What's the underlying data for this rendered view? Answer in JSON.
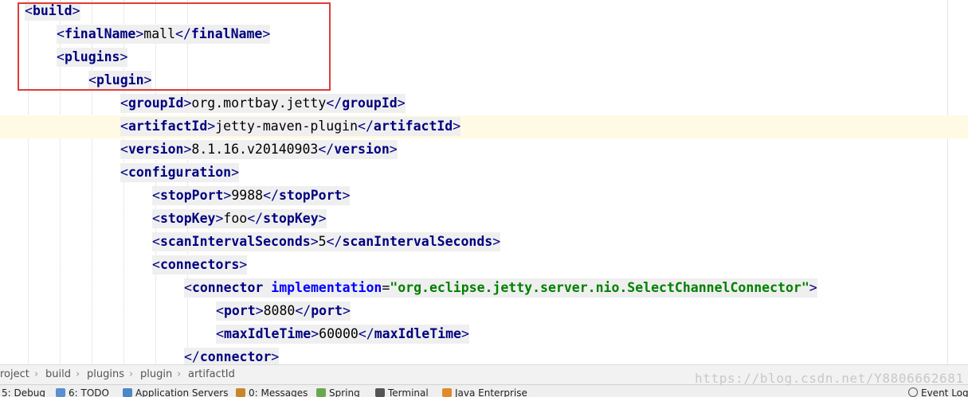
{
  "editor": {
    "current_line_index": 5,
    "lines": [
      {
        "indent": 0,
        "bg": true,
        "tokens": [
          {
            "t": "<",
            "c": "br"
          },
          {
            "t": "build",
            "c": "tn"
          },
          {
            "t": ">",
            "c": "br"
          }
        ]
      },
      {
        "indent": 1,
        "bg": true,
        "tokens": [
          {
            "t": "<",
            "c": "br"
          },
          {
            "t": "finalName",
            "c": "tn"
          },
          {
            "t": ">",
            "c": "br"
          },
          {
            "t": "mall",
            "c": "tx"
          },
          {
            "t": "</",
            "c": "br"
          },
          {
            "t": "finalName",
            "c": "tn"
          },
          {
            "t": ">",
            "c": "br"
          }
        ]
      },
      {
        "indent": 1,
        "bg": true,
        "tokens": [
          {
            "t": "<",
            "c": "br"
          },
          {
            "t": "plugins",
            "c": "tn"
          },
          {
            "t": ">",
            "c": "br"
          }
        ]
      },
      {
        "indent": 2,
        "bg": true,
        "tokens": [
          {
            "t": "<",
            "c": "br"
          },
          {
            "t": "plugin",
            "c": "tn"
          },
          {
            "t": ">",
            "c": "br"
          }
        ]
      },
      {
        "indent": 3,
        "bg": true,
        "tokens": [
          {
            "t": "<",
            "c": "br"
          },
          {
            "t": "groupId",
            "c": "tn"
          },
          {
            "t": ">",
            "c": "br"
          },
          {
            "t": "org.mortbay.jetty",
            "c": "tx"
          },
          {
            "t": "</",
            "c": "br"
          },
          {
            "t": "groupId",
            "c": "tn"
          },
          {
            "t": ">",
            "c": "br"
          }
        ]
      },
      {
        "indent": 3,
        "bg": true,
        "tokens": [
          {
            "t": "<",
            "c": "br"
          },
          {
            "t": "artifactId",
            "c": "tn"
          },
          {
            "t": ">",
            "c": "br"
          },
          {
            "t": "jetty-maven-plugin",
            "c": "tx"
          },
          {
            "t": "</",
            "c": "br"
          },
          {
            "t": "artifactId",
            "c": "tn"
          },
          {
            "t": ">",
            "c": "br"
          }
        ]
      },
      {
        "indent": 3,
        "bg": true,
        "tokens": [
          {
            "t": "<",
            "c": "br"
          },
          {
            "t": "version",
            "c": "tn"
          },
          {
            "t": ">",
            "c": "br"
          },
          {
            "t": "8.1.16.v20140903",
            "c": "tx"
          },
          {
            "t": "</",
            "c": "br"
          },
          {
            "t": "version",
            "c": "tn"
          },
          {
            "t": ">",
            "c": "br"
          }
        ]
      },
      {
        "indent": 3,
        "bg": true,
        "tokens": [
          {
            "t": "<",
            "c": "br"
          },
          {
            "t": "configuration",
            "c": "tn"
          },
          {
            "t": ">",
            "c": "br"
          }
        ]
      },
      {
        "indent": 4,
        "bg": true,
        "tokens": [
          {
            "t": "<",
            "c": "br"
          },
          {
            "t": "stopPort",
            "c": "tn"
          },
          {
            "t": ">",
            "c": "br"
          },
          {
            "t": "9988",
            "c": "tx"
          },
          {
            "t": "</",
            "c": "br"
          },
          {
            "t": "stopPort",
            "c": "tn"
          },
          {
            "t": ">",
            "c": "br"
          }
        ]
      },
      {
        "indent": 4,
        "bg": true,
        "tokens": [
          {
            "t": "<",
            "c": "br"
          },
          {
            "t": "stopKey",
            "c": "tn"
          },
          {
            "t": ">",
            "c": "br"
          },
          {
            "t": "foo",
            "c": "tx"
          },
          {
            "t": "</",
            "c": "br"
          },
          {
            "t": "stopKey",
            "c": "tn"
          },
          {
            "t": ">",
            "c": "br"
          }
        ]
      },
      {
        "indent": 4,
        "bg": true,
        "tokens": [
          {
            "t": "<",
            "c": "br"
          },
          {
            "t": "scanIntervalSeconds",
            "c": "tn"
          },
          {
            "t": ">",
            "c": "br"
          },
          {
            "t": "5",
            "c": "tx"
          },
          {
            "t": "</",
            "c": "br"
          },
          {
            "t": "scanIntervalSeconds",
            "c": "tn"
          },
          {
            "t": ">",
            "c": "br"
          }
        ]
      },
      {
        "indent": 4,
        "bg": true,
        "tokens": [
          {
            "t": "<",
            "c": "br"
          },
          {
            "t": "connectors",
            "c": "tn"
          },
          {
            "t": ">",
            "c": "br"
          }
        ]
      },
      {
        "indent": 5,
        "bg": true,
        "tokens": [
          {
            "t": "<",
            "c": "br"
          },
          {
            "t": "connector",
            "c": "tn"
          },
          {
            "t": " ",
            "c": "tx"
          },
          {
            "t": "implementation",
            "c": "an"
          },
          {
            "t": "=",
            "c": "tx"
          },
          {
            "t": "\"org.eclipse.jetty.server.nio.SelectChannelConnector\"",
            "c": "av"
          },
          {
            "t": ">",
            "c": "br"
          }
        ]
      },
      {
        "indent": 6,
        "bg": true,
        "tokens": [
          {
            "t": "<",
            "c": "br"
          },
          {
            "t": "port",
            "c": "tn"
          },
          {
            "t": ">",
            "c": "br"
          },
          {
            "t": "8080",
            "c": "tx"
          },
          {
            "t": "</",
            "c": "br"
          },
          {
            "t": "port",
            "c": "tn"
          },
          {
            "t": ">",
            "c": "br"
          }
        ]
      },
      {
        "indent": 6,
        "bg": true,
        "tokens": [
          {
            "t": "<",
            "c": "br"
          },
          {
            "t": "maxIdleTime",
            "c": "tn"
          },
          {
            "t": ">",
            "c": "br"
          },
          {
            "t": "60000",
            "c": "tx"
          },
          {
            "t": "</",
            "c": "br"
          },
          {
            "t": "maxIdleTime",
            "c": "tn"
          },
          {
            "t": ">",
            "c": "br"
          }
        ]
      },
      {
        "indent": 5,
        "bg": true,
        "tokens": [
          {
            "t": "</",
            "c": "br"
          },
          {
            "t": "connector",
            "c": "tn"
          },
          {
            "t": ">",
            "c": "br"
          }
        ]
      }
    ]
  },
  "breadcrumb": {
    "items": [
      "roject",
      "build",
      "plugins",
      "plugin",
      "artifactId"
    ]
  },
  "toolwindows": {
    "items": [
      {
        "label": "5: Debug",
        "icon": "debug-icon",
        "color": "#3b7ddd"
      },
      {
        "label": "6: TODO",
        "icon": "todo-icon",
        "color": "#5a8fd0"
      },
      {
        "label": "Application Servers",
        "icon": "app-servers-icon",
        "color": "#4a88c7"
      },
      {
        "label": "0: Messages",
        "icon": "messages-icon",
        "color": "#c9862c"
      },
      {
        "label": "Spring",
        "icon": "spring-icon",
        "color": "#6aa84f"
      },
      {
        "label": "Terminal",
        "icon": "terminal-icon",
        "color": "#555555"
      },
      {
        "label": "Java Enterprise",
        "icon": "java-enterprise-icon",
        "color": "#e08a2c"
      }
    ],
    "event_log": "Event Log"
  },
  "watermark": "https://blog.csdn.net/Y8806662681",
  "colors": {
    "highlight_box": "#e03c36",
    "tag_name": "#000080",
    "attr_name": "#0000ff",
    "attr_value": "#008000",
    "current_line": "#fffae3"
  }
}
